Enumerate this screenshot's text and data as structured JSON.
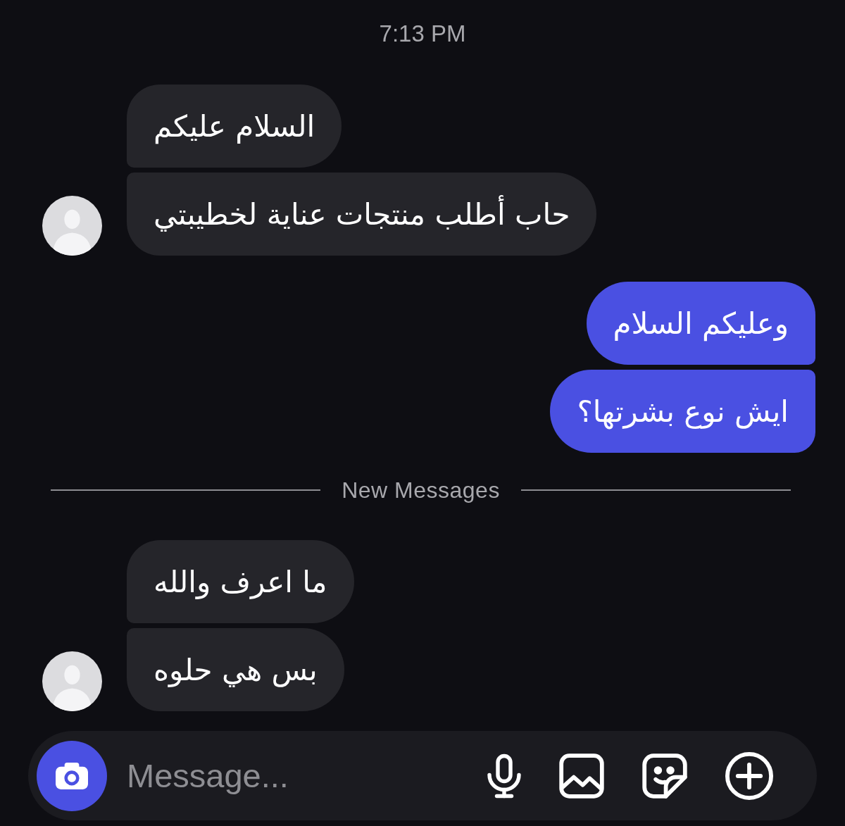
{
  "thread": [
    {
      "kind": "timestamp",
      "text": "7:13 PM"
    },
    {
      "kind": "incoming",
      "messages": [
        "السلام عليكم",
        "حاب أطلب منتجات عناية لخطيبتي"
      ]
    },
    {
      "kind": "outgoing",
      "messages": [
        "وعليكم السلام",
        "ايش نوع بشرتها؟"
      ]
    },
    {
      "kind": "divider",
      "text": "New Messages"
    },
    {
      "kind": "incoming",
      "messages": [
        "ما اعرف والله",
        "بس هي حلوه"
      ]
    }
  ],
  "composer": {
    "placeholder": "Message..."
  }
}
